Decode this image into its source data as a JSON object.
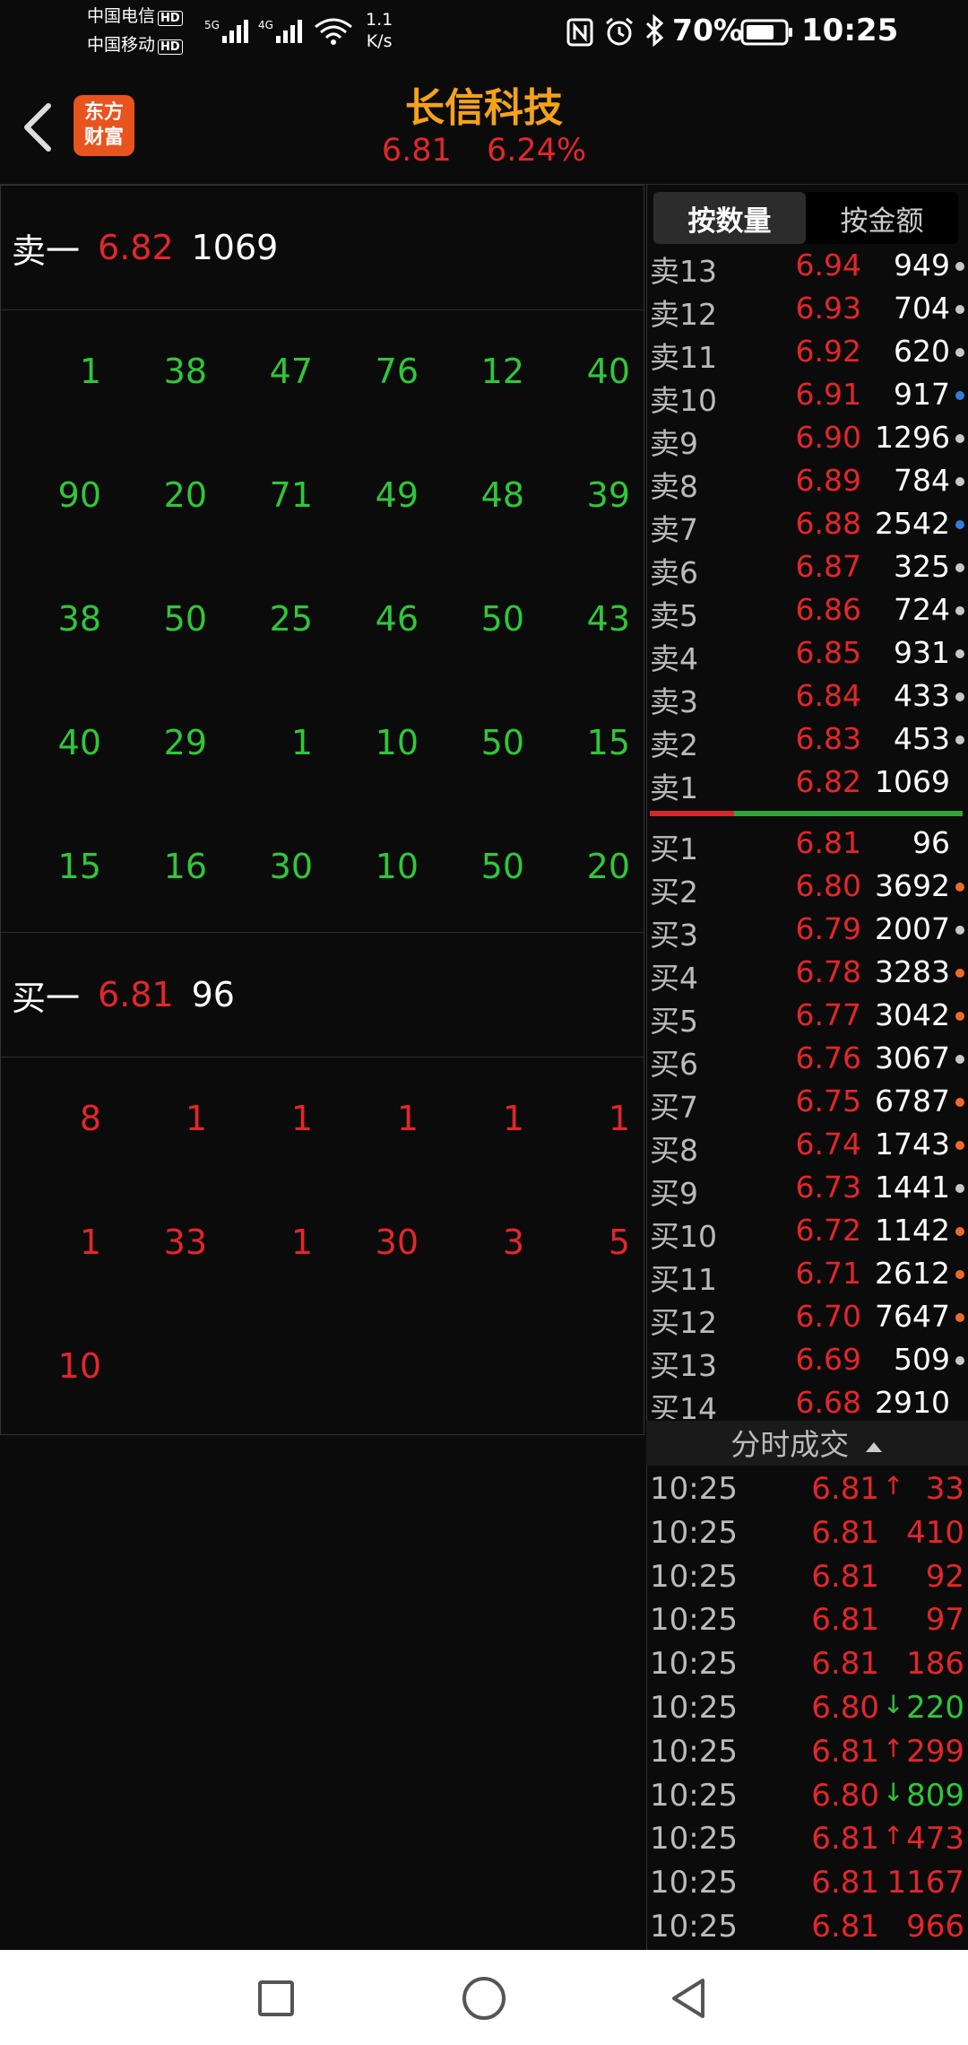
{
  "status_bar": {
    "carrier1": "中国电信",
    "carrier2": "中国移动",
    "hd": "HD",
    "net1": "5G",
    "net2": "4G",
    "speed_value": "1.1",
    "speed_unit": "K/s",
    "battery": "70%",
    "time": "10:25",
    "icons": [
      "nfc-icon",
      "alarm-icon",
      "bluetooth-icon",
      "battery-icon"
    ]
  },
  "header": {
    "title": "长信科技",
    "price": "6.81",
    "change_pct": "6.24%",
    "logo_line1": "东方",
    "logo_line2": "财富"
  },
  "left": {
    "sell_label": "卖一",
    "sell_price": "6.82",
    "sell_volume": "1069",
    "sell_queue": [
      [
        "1",
        "38",
        "47",
        "76",
        "12",
        "40"
      ],
      [
        "90",
        "20",
        "71",
        "49",
        "48",
        "39"
      ],
      [
        "38",
        "50",
        "25",
        "46",
        "50",
        "43"
      ],
      [
        "40",
        "29",
        "1",
        "10",
        "50",
        "15"
      ],
      [
        "15",
        "16",
        "30",
        "10",
        "50",
        "20"
      ]
    ],
    "buy_label": "买一",
    "buy_price": "6.81",
    "buy_volume": "96",
    "buy_queue": [
      [
        "8",
        "1",
        "1",
        "1",
        "1",
        "1"
      ],
      [
        "1",
        "33",
        "1",
        "30",
        "3",
        "5"
      ],
      [
        "10",
        "",
        "",
        "",
        "",
        ""
      ]
    ]
  },
  "right": {
    "tab_quantity": "按数量",
    "tab_amount": "按金额",
    "asks": [
      {
        "label": "卖13",
        "price": "6.94",
        "volume": "949",
        "dot": "#c8c8c8"
      },
      {
        "label": "卖12",
        "price": "6.93",
        "volume": "704",
        "dot": "#c8c8c8"
      },
      {
        "label": "卖11",
        "price": "6.92",
        "volume": "620",
        "dot": "#c8c8c8"
      },
      {
        "label": "卖10",
        "price": "6.91",
        "volume": "917",
        "dot": "#2f7fd6"
      },
      {
        "label": "卖9",
        "price": "6.90",
        "volume": "1296",
        "dot": "#c8c8c8"
      },
      {
        "label": "卖8",
        "price": "6.89",
        "volume": "784",
        "dot": "#c8c8c8"
      },
      {
        "label": "卖7",
        "price": "6.88",
        "volume": "2542",
        "dot": "#2f7fd6"
      },
      {
        "label": "卖6",
        "price": "6.87",
        "volume": "325",
        "dot": "#c8c8c8"
      },
      {
        "label": "卖5",
        "price": "6.86",
        "volume": "724",
        "dot": "#c8c8c8"
      },
      {
        "label": "卖4",
        "price": "6.85",
        "volume": "931",
        "dot": "#c8c8c8"
      },
      {
        "label": "卖3",
        "price": "6.84",
        "volume": "433",
        "dot": "#c8c8c8"
      },
      {
        "label": "卖2",
        "price": "6.83",
        "volume": "453",
        "dot": "#c8c8c8"
      },
      {
        "label": "卖1",
        "price": "6.82",
        "volume": "1069",
        "dot": ""
      }
    ],
    "bids": [
      {
        "label": "买1",
        "price": "6.81",
        "volume": "96",
        "dot": ""
      },
      {
        "label": "买2",
        "price": "6.80",
        "volume": "3692",
        "dot": "#ee6a2a"
      },
      {
        "label": "买3",
        "price": "6.79",
        "volume": "2007",
        "dot": "#c8c8c8"
      },
      {
        "label": "买4",
        "price": "6.78",
        "volume": "3283",
        "dot": "#ee6a2a"
      },
      {
        "label": "买5",
        "price": "6.77",
        "volume": "3042",
        "dot": "#ee6a2a"
      },
      {
        "label": "买6",
        "price": "6.76",
        "volume": "3067",
        "dot": "#c8c8c8"
      },
      {
        "label": "买7",
        "price": "6.75",
        "volume": "6787",
        "dot": "#ee6a2a"
      },
      {
        "label": "买8",
        "price": "6.74",
        "volume": "1743",
        "dot": "#ee6a2a"
      },
      {
        "label": "买9",
        "price": "6.73",
        "volume": "1441",
        "dot": "#c8c8c8"
      },
      {
        "label": "买10",
        "price": "6.72",
        "volume": "1142",
        "dot": "#ee6a2a"
      },
      {
        "label": "买11",
        "price": "6.71",
        "volume": "2612",
        "dot": "#ee6a2a"
      },
      {
        "label": "买12",
        "price": "6.70",
        "volume": "7647",
        "dot": "#ee6a2a"
      },
      {
        "label": "买13",
        "price": "6.69",
        "volume": "509",
        "dot": "#c8c8c8"
      },
      {
        "label": "买14",
        "price": "6.68",
        "volume": "2910",
        "dot": ""
      }
    ],
    "ticks_title": "分时成交",
    "ticks": [
      {
        "time": "10:25",
        "price": "6.81",
        "arrow": "↑",
        "volume": "33",
        "color": "#e3262b"
      },
      {
        "time": "10:25",
        "price": "6.81",
        "arrow": "",
        "volume": "410",
        "color": "#e3262b"
      },
      {
        "time": "10:25",
        "price": "6.81",
        "arrow": "",
        "volume": "92",
        "color": "#e3262b"
      },
      {
        "time": "10:25",
        "price": "6.81",
        "arrow": "",
        "volume": "97",
        "color": "#e3262b"
      },
      {
        "time": "10:25",
        "price": "6.81",
        "arrow": "",
        "volume": "186",
        "color": "#e3262b"
      },
      {
        "time": "10:25",
        "price": "6.80",
        "arrow": "↓",
        "volume": "220",
        "color": "#2fc73a"
      },
      {
        "time": "10:25",
        "price": "6.81",
        "arrow": "↑",
        "volume": "299",
        "color": "#e3262b"
      },
      {
        "time": "10:25",
        "price": "6.80",
        "arrow": "↓",
        "volume": "809",
        "color": "#2fc73a"
      },
      {
        "time": "10:25",
        "price": "6.81",
        "arrow": "↑",
        "volume": "473",
        "color": "#e3262b"
      },
      {
        "time": "10:25",
        "price": "6.81",
        "arrow": "",
        "volume": "1167",
        "color": "#e3262b"
      },
      {
        "time": "10:25",
        "price": "6.81",
        "arrow": "",
        "volume": "966",
        "color": "#e3262b"
      }
    ]
  },
  "nav": {
    "icons": [
      "recents-square-icon",
      "home-circle-icon",
      "back-triangle-icon"
    ]
  }
}
